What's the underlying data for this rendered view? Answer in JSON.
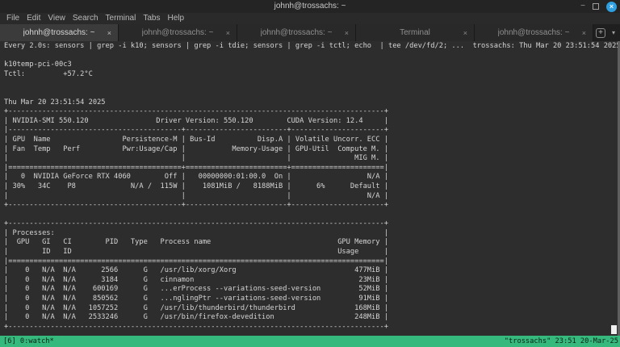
{
  "window": {
    "title": "johnh@trossachs: ~",
    "controls": {
      "minimize": "−",
      "close": "×"
    }
  },
  "menubar": {
    "items": [
      "File",
      "Edit",
      "View",
      "Search",
      "Terminal",
      "Tabs",
      "Help"
    ]
  },
  "tabbar": {
    "tabs": [
      {
        "label": "johnh@trossachs: ~",
        "active": true
      },
      {
        "label": "johnh@trossachs: ~",
        "active": false
      },
      {
        "label": "johnh@trossachs: ~",
        "active": false
      },
      {
        "label": "Terminal",
        "active": false
      },
      {
        "label": "johnh@trossachs: ~",
        "active": false
      }
    ],
    "close_icon": "×",
    "new_tab_icon": "+",
    "tab_menu_icon": "▾"
  },
  "terminal": {
    "lines": [
      "Every 2.0s: sensors | grep -i k10; sensors | grep -i tdie; sensors | grep -i tctl; echo  | tee /dev/fd/2; ...  trossachs: Thu Mar 20 23:51:54 2025",
      "",
      "k10temp-pci-00c3",
      "Tctl:         +57.2°C",
      "",
      "",
      "Thu Mar 20 23:51:54 2025",
      "+-----------------------------------------------------------------------------------------+",
      "| NVIDIA-SMI 550.120                Driver Version: 550.120        CUDA Version: 12.4     |",
      "|-----------------------------------------+------------------------+----------------------+",
      "| GPU  Name                 Persistence-M | Bus-Id          Disp.A | Volatile Uncorr. ECC |",
      "| Fan  Temp   Perf          Pwr:Usage/Cap |           Memory-Usage | GPU-Util  Compute M. |",
      "|                                         |                        |               MIG M. |",
      "|=========================================+========================+======================|",
      "|   0  NVIDIA GeForce RTX 4060        Off |   00000000:01:00.0  On |                  N/A |",
      "| 30%   34C    P8             N/A /  115W |    1081MiB /   8188MiB |      6%      Default |",
      "|                                         |                        |                  N/A |",
      "+-----------------------------------------+------------------------+----------------------+",
      "",
      "+-----------------------------------------------------------------------------------------+",
      "| Processes:                                                                              |",
      "|  GPU   GI   CI        PID   Type   Process name                              GPU Memory |",
      "|        ID   ID                                                               Usage      |",
      "|=========================================================================================|",
      "|    0   N/A  N/A      2566      G   /usr/lib/xorg/Xorg                            477MiB |",
      "|    0   N/A  N/A      3184      G   cinnamon                                       23MiB |",
      "|    0   N/A  N/A    600169      G   ...erProcess --variations-seed-version         52MiB |",
      "|    0   N/A  N/A    850562      G   ...nglingPtr --variations-seed-version         91MiB |",
      "|    0   N/A  N/A   1057252      G   /usr/lib/thunderbird/thunderbird              168MiB |",
      "|    0   N/A  N/A   2533246      G   /usr/bin/firefox-devedition                   248MiB |",
      "+-----------------------------------------------------------------------------------------+"
    ]
  },
  "statusbar": {
    "left": "[6] 0:watch*",
    "right": "\"trossachs\" 23:51 20-Mar-25",
    "bg_color": "#35b97c",
    "text_color": "#0b2418"
  },
  "colors": {
    "terminal_bg": "#2d2d2d",
    "terminal_fg": "#d5d5d5",
    "titlebar_bg": "#242424",
    "close_button": "#2f9fe0",
    "active_tab_bg": "#3b3b3b"
  }
}
